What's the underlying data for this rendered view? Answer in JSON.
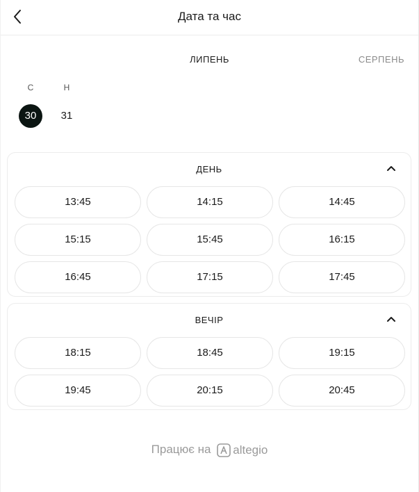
{
  "header": {
    "title": "Дата та час"
  },
  "calendar": {
    "current_month": "ЛИПЕНЬ",
    "next_month": "СЕРПЕНЬ",
    "days": [
      {
        "weekday": "С",
        "day": "30",
        "selected": true
      },
      {
        "weekday": "Н",
        "day": "31",
        "selected": false
      }
    ]
  },
  "sections": [
    {
      "title": "ДЕНЬ",
      "slots": [
        "13:45",
        "14:15",
        "14:45",
        "15:15",
        "15:45",
        "16:15",
        "16:45",
        "17:15",
        "17:45"
      ]
    },
    {
      "title": "ВЕЧІР",
      "slots": [
        "18:15",
        "18:45",
        "19:15",
        "19:45",
        "20:15",
        "20:45"
      ]
    }
  ],
  "footer": {
    "powered_by": "Працює на",
    "brand": "altegio"
  },
  "colors": {
    "selected_day_bg": "#0b1512",
    "muted_text": "#8a8a8a",
    "border": "#e6e6e6"
  }
}
